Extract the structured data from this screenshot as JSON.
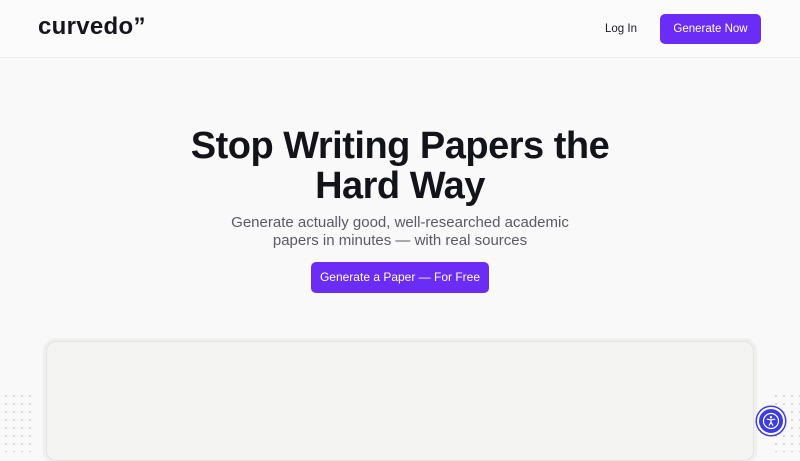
{
  "header": {
    "logo": "curvedo”",
    "login_label": "Log In",
    "generate_now_label": "Generate Now"
  },
  "hero": {
    "title_line1": "Stop Writing Papers the",
    "title_line2": "Hard Way",
    "subtitle_line1": "Generate actually good, well-researched academic",
    "subtitle_line2": "papers in minutes — with real sources",
    "cta_label": "Generate a Paper — For Free"
  },
  "accessibility": {
    "icon": "accessibility-icon"
  },
  "colors": {
    "accent": "#6b2cf5",
    "accessibility_button": "#3d3ce0"
  }
}
